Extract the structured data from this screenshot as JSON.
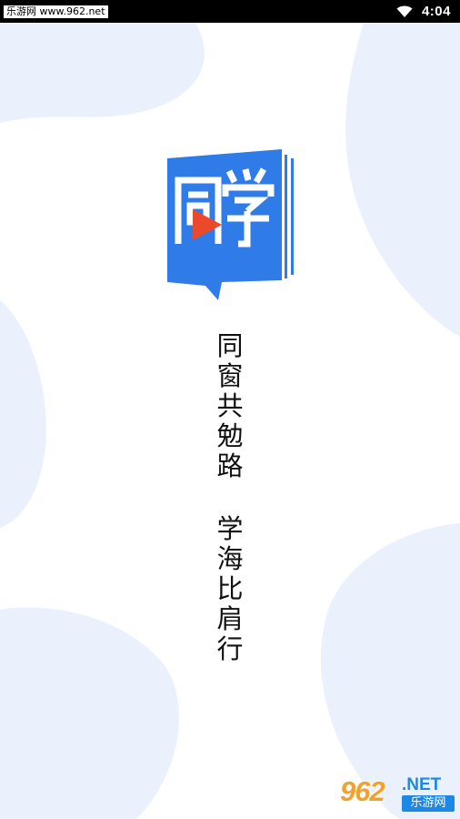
{
  "status_bar": {
    "watermark_text": "乐游网 www.962.net",
    "time": "4:04",
    "wifi_icon": "wifi-icon"
  },
  "logo": {
    "text": "同学",
    "icon": "play-triangle-icon",
    "brand_color": "#2f7be8",
    "accent_color": "#ea4a2b"
  },
  "slogan": {
    "line1": [
      "同",
      "窗",
      "共",
      "勉",
      "路"
    ],
    "line2": [
      "学",
      "海",
      "比",
      "肩",
      "行"
    ]
  },
  "watermark": {
    "number": "962",
    "suffix": ".NET",
    "site_name": "乐游网"
  },
  "colors": {
    "blob": "#eaf1fc",
    "text": "#111111"
  }
}
